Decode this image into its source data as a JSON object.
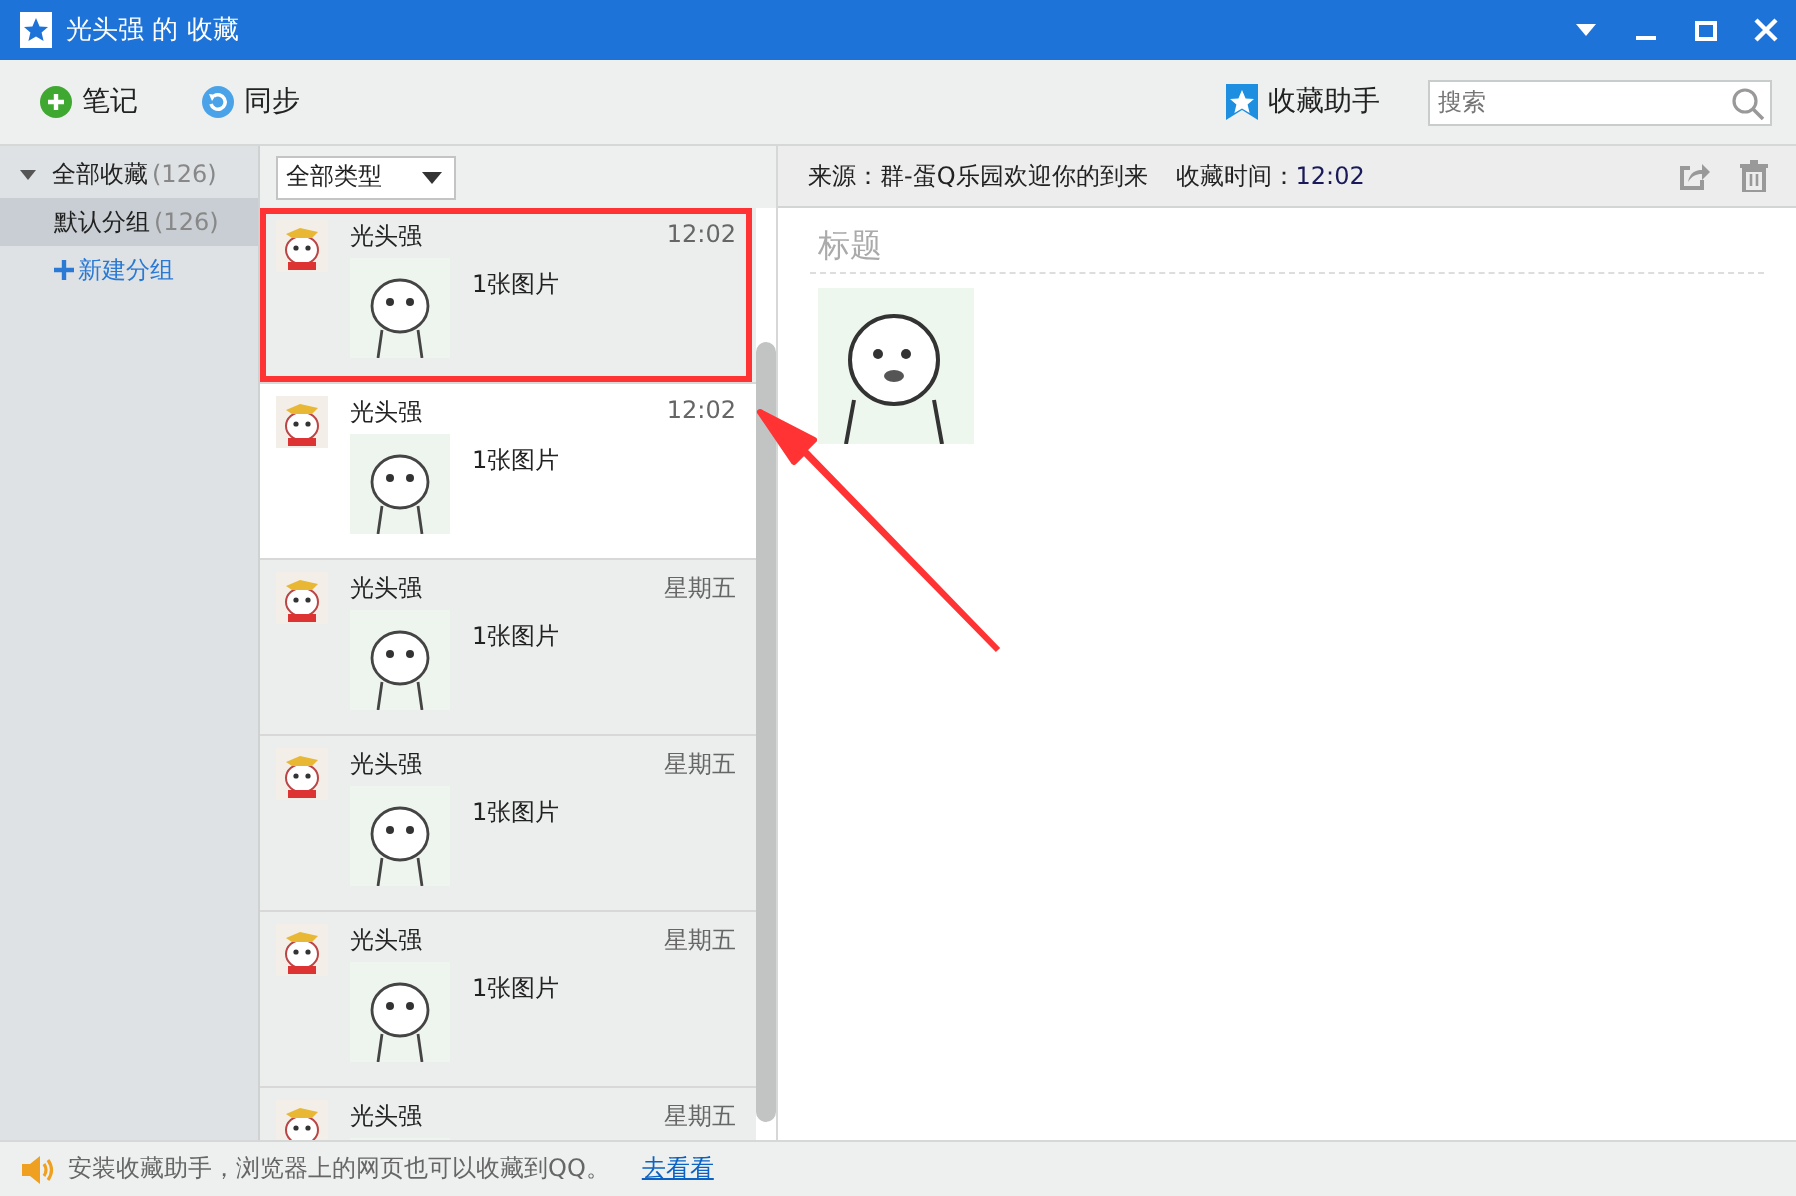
{
  "window": {
    "title": "光头强 的 收藏"
  },
  "toolbar": {
    "buttons": [
      {
        "label": "笔记",
        "kind": "note"
      },
      {
        "label": "同步",
        "kind": "sync"
      }
    ],
    "assistant": "收藏助手",
    "search": {
      "placeholder": "搜索"
    }
  },
  "sidebar": {
    "items": [
      {
        "label": "全部收藏",
        "count": "(126)",
        "expanded": true,
        "selected": false,
        "children": [
          {
            "label": "默认分组",
            "count": "(126)",
            "selected": true
          }
        ]
      }
    ],
    "new_group": "新建分组"
  },
  "filter": {
    "value": "全部类型"
  },
  "list": {
    "items": [
      {
        "name": "光头强",
        "time": "12:02",
        "summary": "1张图片",
        "selected": false,
        "marked": true
      },
      {
        "name": "光头强",
        "time": "12:02",
        "summary": "1张图片",
        "selected": true,
        "marked": false
      },
      {
        "name": "光头强",
        "time": "星期五",
        "summary": "1张图片",
        "selected": false,
        "marked": false
      },
      {
        "name": "光头强",
        "time": "星期五",
        "summary": "1张图片",
        "selected": false,
        "marked": false
      },
      {
        "name": "光头强",
        "time": "星期五",
        "summary": "1张图片",
        "selected": false,
        "marked": false
      },
      {
        "name": "光头强",
        "time": "星期五",
        "selected": false,
        "marked": false
      }
    ]
  },
  "detail": {
    "source": "来源：群-蛋Q乐园欢迎你的到来",
    "time_label": "收藏时间：",
    "time": "12:02",
    "title_placeholder": "标题"
  },
  "status_bar": {
    "message": "安装收藏助手，浏览器上的网页也可以收藏到QQ。",
    "link": "去看看"
  }
}
